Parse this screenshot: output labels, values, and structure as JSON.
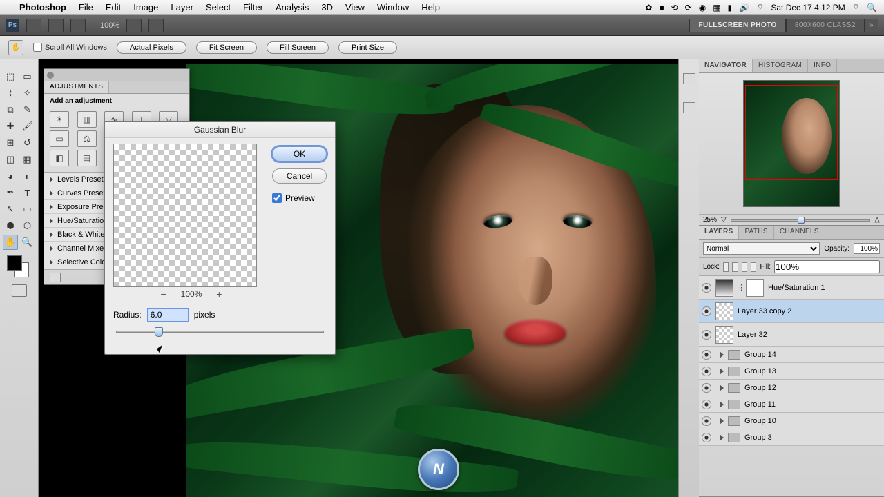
{
  "menubar": {
    "app": "Photoshop",
    "items": [
      "File",
      "Edit",
      "Image",
      "Layer",
      "Select",
      "Filter",
      "Analysis",
      "3D",
      "View",
      "Window",
      "Help"
    ],
    "clock": "Sat Dec 17  4:12 PM"
  },
  "appbar": {
    "zoom": "100%",
    "tab_active": "FULLSCREEN PHOTO",
    "tab_inactive": "800X600 CLASS2"
  },
  "ctrlbar": {
    "scroll_label": "Scroll All Windows",
    "btns": [
      "Actual Pixels",
      "Fit Screen",
      "Fill Screen",
      "Print Size"
    ]
  },
  "adjustments": {
    "tab": "ADJUSTMENTS",
    "subtitle": "Add an adjustment",
    "presets": [
      "Levels Presets",
      "Curves Presets",
      "Exposure Presets",
      "Hue/Saturation Presets",
      "Black & White Presets",
      "Channel Mixer Presets",
      "Selective Color Presets"
    ]
  },
  "dialog": {
    "title": "Gaussian Blur",
    "ok": "OK",
    "cancel": "Cancel",
    "preview": "Preview",
    "zoom": "100%",
    "radius_label": "Radius:",
    "radius_value": "6.0",
    "radius_unit": "pixels"
  },
  "navigator": {
    "tabs": [
      "NAVIGATOR",
      "HISTOGRAM",
      "INFO"
    ],
    "zoom": "25%"
  },
  "layers": {
    "tabs": [
      "LAYERS",
      "PATHS",
      "CHANNELS"
    ],
    "blend": "Normal",
    "opacity_label": "Opacity:",
    "opacity": "100%",
    "lock_label": "Lock:",
    "fill_label": "Fill:",
    "fill": "100%",
    "rows": [
      {
        "name": "Hue/Saturation 1",
        "type": "adj"
      },
      {
        "name": "Layer 33 copy 2",
        "type": "layer",
        "sel": true
      },
      {
        "name": "Layer 32",
        "type": "layer"
      },
      {
        "name": "Group 14",
        "type": "group"
      },
      {
        "name": "Group 13",
        "type": "group"
      },
      {
        "name": "Group 12",
        "type": "group"
      },
      {
        "name": "Group 11",
        "type": "group"
      },
      {
        "name": "Group 10",
        "type": "group"
      },
      {
        "name": "Group 3",
        "type": "group"
      }
    ]
  }
}
